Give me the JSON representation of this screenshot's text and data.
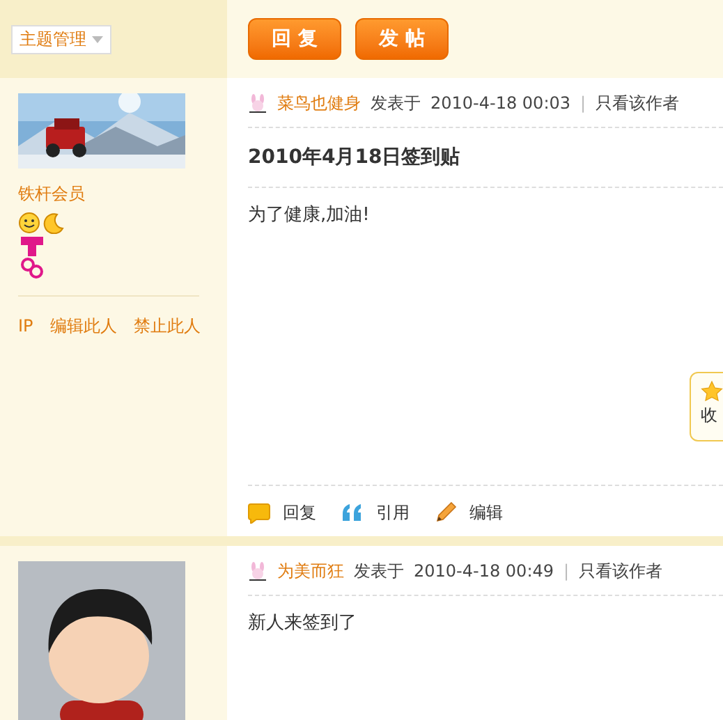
{
  "toolbar": {
    "manage_menu": "主题管理",
    "buttons": [
      "回 复",
      "发 帖"
    ]
  },
  "posts": [
    {
      "rank": "铁杆会员",
      "admin_links": [
        "IP",
        "编辑此人",
        "禁止此人"
      ],
      "author": "菜鸟也健身",
      "posted_label": "发表于",
      "date": "2010-4-18 00:03",
      "separator": "|",
      "only_author": "只看该作者",
      "title": "2010年4月18日签到贴",
      "body": "为了健康,加油!",
      "favorite": "收",
      "actions": [
        {
          "kind": "reply",
          "label": "回复"
        },
        {
          "kind": "quote",
          "label": "引用"
        },
        {
          "kind": "edit",
          "label": "编辑"
        }
      ]
    },
    {
      "avatar": {
        "kind": "figure"
      },
      "author": "为美而狂",
      "posted_label": "发表于",
      "date": "2010-4-18 00:49",
      "separator": "|",
      "only_author": "只看该作者",
      "body": "新人来签到了"
    }
  ]
}
